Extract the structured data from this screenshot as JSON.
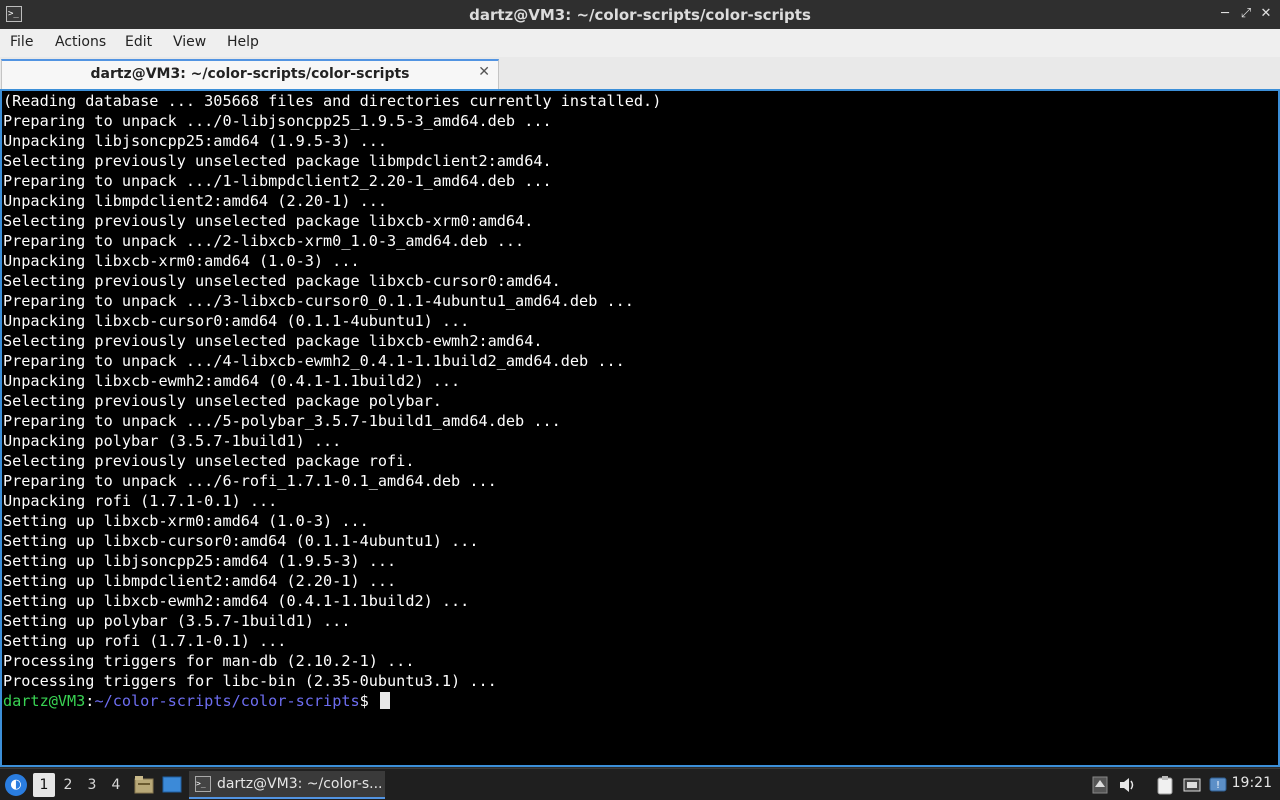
{
  "window": {
    "title": "dartz@VM3: ~/color-scripts/color-scripts",
    "app_icon": "terminal-icon",
    "controls": {
      "minimize": "─",
      "restore": "⤢",
      "close": "✕"
    }
  },
  "menu": [
    "File",
    "Actions",
    "Edit",
    "View",
    "Help"
  ],
  "tab": {
    "label": "dartz@VM3: ~/color-scripts/color-scripts",
    "close": "✕"
  },
  "terminal": {
    "lines": [
      "(Reading database ... 305668 files and directories currently installed.)",
      "Preparing to unpack .../0-libjsoncpp25_1.9.5-3_amd64.deb ...",
      "Unpacking libjsoncpp25:amd64 (1.9.5-3) ...",
      "Selecting previously unselected package libmpdclient2:amd64.",
      "Preparing to unpack .../1-libmpdclient2_2.20-1_amd64.deb ...",
      "Unpacking libmpdclient2:amd64 (2.20-1) ...",
      "Selecting previously unselected package libxcb-xrm0:amd64.",
      "Preparing to unpack .../2-libxcb-xrm0_1.0-3_amd64.deb ...",
      "Unpacking libxcb-xrm0:amd64 (1.0-3) ...",
      "Selecting previously unselected package libxcb-cursor0:amd64.",
      "Preparing to unpack .../3-libxcb-cursor0_0.1.1-4ubuntu1_amd64.deb ...",
      "Unpacking libxcb-cursor0:amd64 (0.1.1-4ubuntu1) ...",
      "Selecting previously unselected package libxcb-ewmh2:amd64.",
      "Preparing to unpack .../4-libxcb-ewmh2_0.4.1-1.1build2_amd64.deb ...",
      "Unpacking libxcb-ewmh2:amd64 (0.4.1-1.1build2) ...",
      "Selecting previously unselected package polybar.",
      "Preparing to unpack .../5-polybar_3.5.7-1build1_amd64.deb ...",
      "Unpacking polybar (3.5.7-1build1) ...",
      "Selecting previously unselected package rofi.",
      "Preparing to unpack .../6-rofi_1.7.1-0.1_amd64.deb ...",
      "Unpacking rofi (1.7.1-0.1) ...",
      "Setting up libxcb-xrm0:amd64 (1.0-3) ...",
      "Setting up libxcb-cursor0:amd64 (0.1.1-4ubuntu1) ...",
      "Setting up libjsoncpp25:amd64 (1.9.5-3) ...",
      "Setting up libmpdclient2:amd64 (2.20-1) ...",
      "Setting up libxcb-ewmh2:amd64 (0.4.1-1.1build2) ...",
      "Setting up polybar (3.5.7-1build1) ...",
      "Setting up rofi (1.7.1-0.1) ...",
      "Processing triggers for man-db (2.10.2-1) ...",
      "Processing triggers for libc-bin (2.35-0ubuntu3.1) ..."
    ],
    "prompt": {
      "user": "dartz@VM3",
      "sep": ":",
      "path": "~/color-scripts/color-scripts",
      "dollar": "$ "
    },
    "colors": {
      "background": "#000000",
      "text": "#ffffff",
      "prompt_user": "#39d353",
      "prompt_path": "#6d6df0"
    }
  },
  "taskbar": {
    "start_icon": "distro-menu-icon",
    "workspaces": [
      "1",
      "2",
      "3",
      "4"
    ],
    "active_workspace": "1",
    "launchers": [
      "file-manager-icon",
      "show-desktop-icon"
    ],
    "task_label": "dartz@VM3: ~/color-s...",
    "tray": [
      "scroll-up-icon",
      "volume-icon",
      "clipboard-icon",
      "network-icon",
      "update-notifier-icon"
    ],
    "clock": "19:21"
  }
}
